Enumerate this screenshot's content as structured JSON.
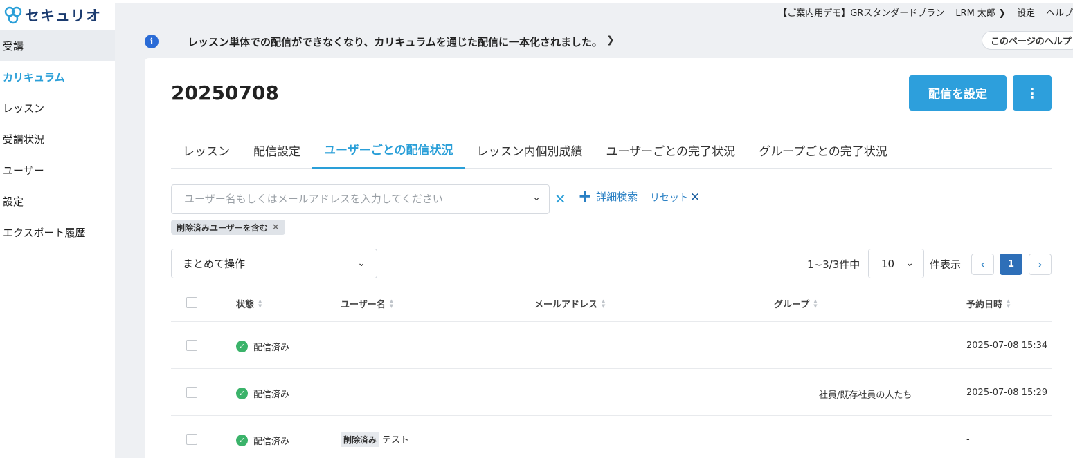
{
  "app": {
    "logo_text": "セキュリオ"
  },
  "sidebar": {
    "items": [
      {
        "label": "受講"
      },
      {
        "label": "カリキュラム"
      },
      {
        "label": "レッスン"
      },
      {
        "label": "受講状況"
      },
      {
        "label": "ユーザー"
      },
      {
        "label": "設定"
      },
      {
        "label": "エクスポート履歴"
      }
    ]
  },
  "topbar": {
    "plan": "【ご案内用デモ】GRスタンダードプラン",
    "user": "LRM 太郎 ❯",
    "settings": "設定",
    "help": "ヘルプ"
  },
  "notice": {
    "text": "レッスン単体での配信ができなくなり、カリキュラムを通じた配信に一本化されました。",
    "help_button": "このページのヘルプ"
  },
  "page": {
    "title": "20250708",
    "primary_button": "配信を設定",
    "more_button": "⋮"
  },
  "tabs": [
    {
      "label": "レッスン"
    },
    {
      "label": "配信設定"
    },
    {
      "label": "ユーザーごとの配信状況"
    },
    {
      "label": "レッスン内個別成績"
    },
    {
      "label": "ユーザーごとの完了状況"
    },
    {
      "label": "グループごとの完了状況"
    }
  ],
  "filter": {
    "search_placeholder": "ユーザー名もしくはメールアドレスを入力してください",
    "advanced_search": "詳細検索",
    "reset": "リセット",
    "chip": "削除済みユーザーを含む"
  },
  "toolbar": {
    "bulk_action": "まとめて操作",
    "count": "1~3/3件中",
    "page_size": "10",
    "per_page_label": "件表示",
    "current_page": "1"
  },
  "table": {
    "headers": {
      "status": "状態",
      "user": "ユーザー名",
      "email": "メールアドレス",
      "group": "グループ",
      "reserved": "予約日時"
    },
    "rows": [
      {
        "status": "配信済み",
        "user": "",
        "deleted": "",
        "email": "",
        "group": "",
        "reserved": "2025-07-08 15:34"
      },
      {
        "status": "配信済み",
        "user": "",
        "deleted": "",
        "email": "",
        "group": "社員/既存社員の人たち",
        "reserved": "2025-07-08 15:29"
      },
      {
        "status": "配信済み",
        "user": "テスト",
        "deleted": "削除済み",
        "email": "",
        "group": "",
        "reserved": "-"
      }
    ]
  },
  "colors": {
    "accent": "#2a9fd8",
    "primary_button": "#2d9fdc",
    "success": "#3bb36a",
    "info": "#2a6bd6"
  }
}
